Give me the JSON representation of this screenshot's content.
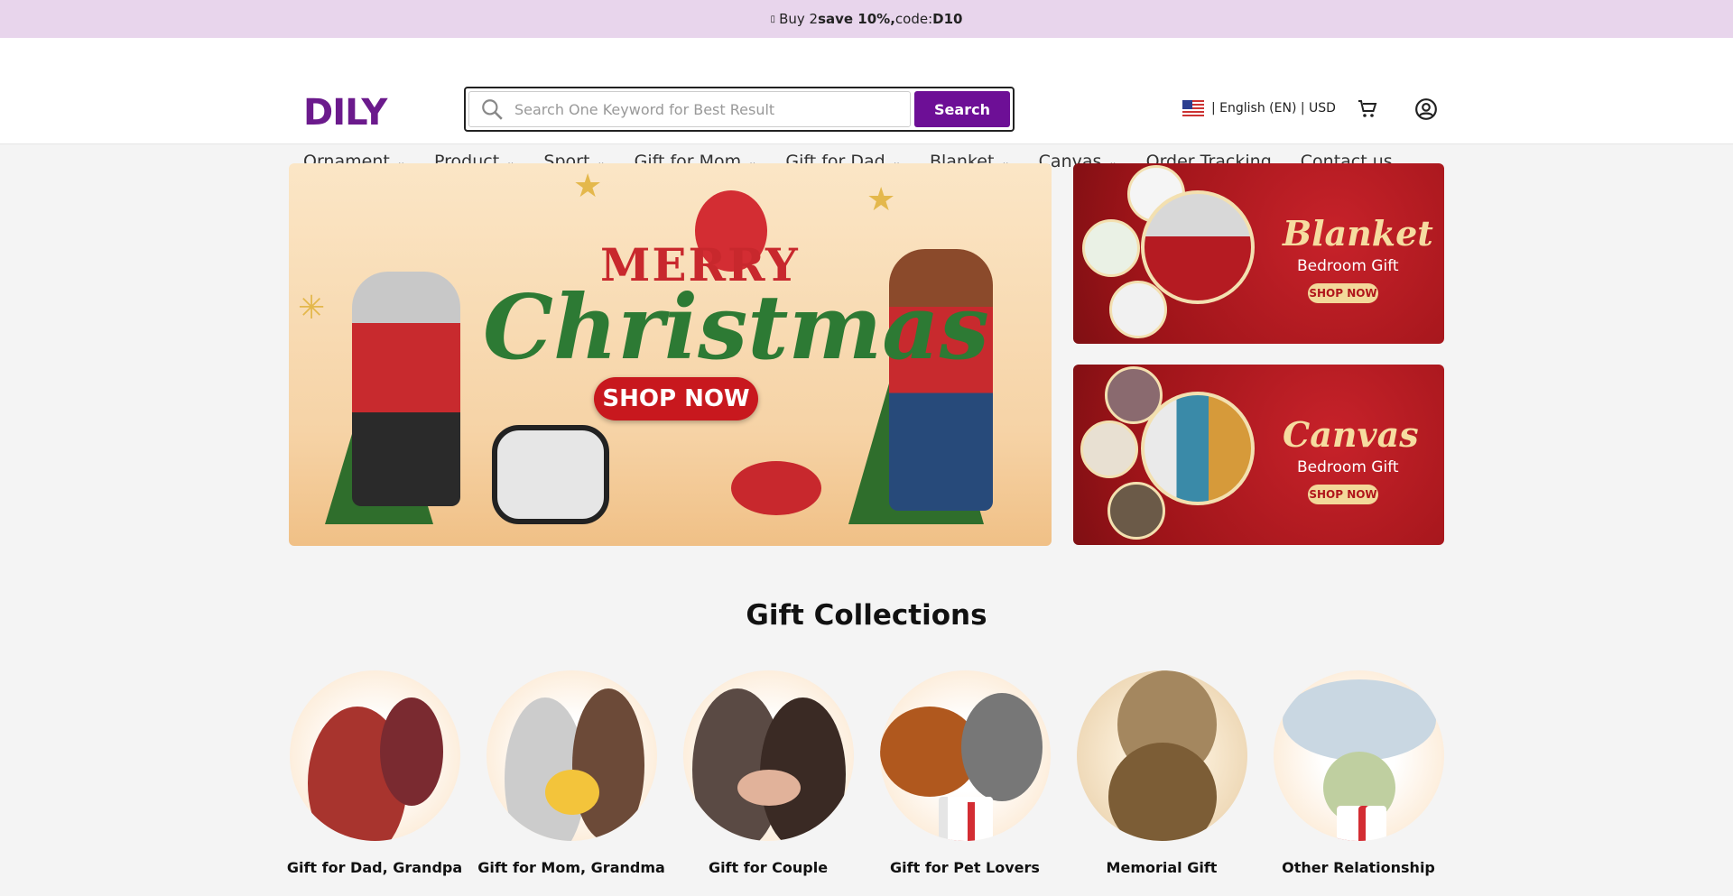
{
  "promo": {
    "prefix_icon": "gift-icon",
    "text_a": "Buy 2 ",
    "text_b": "save 10%,",
    "text_c": " code: ",
    "text_d": "D10"
  },
  "header": {
    "logo": "DILY",
    "search": {
      "placeholder": "Search One Keyword for Best Result",
      "button_label": "Search"
    },
    "locale_label": "| English (EN) | USD",
    "cart_icon": "cart-icon",
    "user_icon": "user-circle-icon"
  },
  "nav": {
    "items": [
      {
        "label": "Ornament",
        "dropdown": true
      },
      {
        "label": "Product",
        "dropdown": true
      },
      {
        "label": "Sport",
        "dropdown": true
      },
      {
        "label": "Gift for Mom",
        "dropdown": true
      },
      {
        "label": "Gift for Dad",
        "dropdown": true
      },
      {
        "label": "Blanket",
        "dropdown": true
      },
      {
        "label": "Canvas",
        "dropdown": true
      },
      {
        "label": "Order Tracking",
        "dropdown": false
      },
      {
        "label": "Contact us",
        "dropdown": false
      }
    ],
    "chevron": "⌄"
  },
  "hero": {
    "main": {
      "line1": "MERRY",
      "line2": "Christmas",
      "cta": "SHOP NOW"
    },
    "side": [
      {
        "title": "Blanket",
        "subtitle": "Bedroom Gift",
        "cta": "SHOP NOW"
      },
      {
        "title": "Canvas",
        "subtitle": "Bedroom Gift",
        "cta": "SHOP NOW"
      }
    ]
  },
  "collections": {
    "title": "Gift Collections",
    "items": [
      {
        "label": "Gift for Dad, Grandpa"
      },
      {
        "label": "Gift for Mom, Grandma"
      },
      {
        "label": "Gift for Couple"
      },
      {
        "label": "Gift for Pet Lovers"
      },
      {
        "label": "Memorial Gift"
      },
      {
        "label": "Other Relationship"
      }
    ]
  },
  "colors": {
    "brand": "#6d0f96",
    "promo_bg": "#e8d5ec",
    "banner_red": "#b0151b"
  }
}
